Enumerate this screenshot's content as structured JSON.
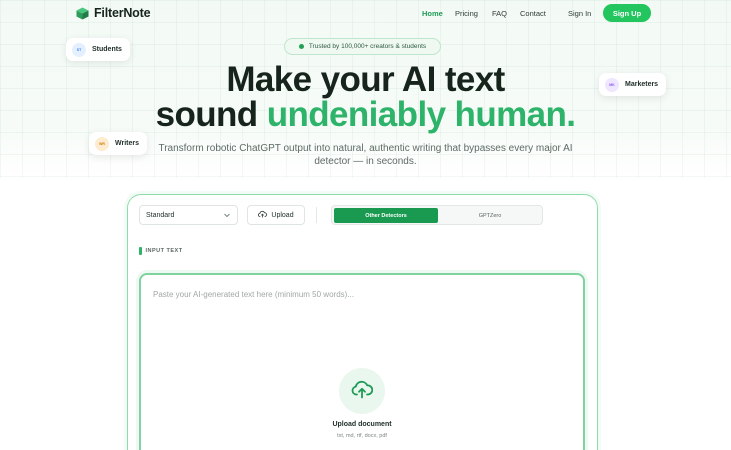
{
  "header": {
    "brand": "FilterNote",
    "nav": [
      {
        "label": "Home",
        "active": true
      },
      {
        "label": "Pricing",
        "active": false
      },
      {
        "label": "FAQ",
        "active": false
      },
      {
        "label": "Contact",
        "active": false
      }
    ],
    "sign_in": "Sign In",
    "sign_up": "Sign Up"
  },
  "hero": {
    "trust_badge": "Trusted by 100,000+ creators & students",
    "headline_line1": "Make your AI text",
    "headline_line2_prefix": "sound ",
    "headline_line2_highlight": "undeniably human.",
    "subtitle": "Transform robotic ChatGPT output into natural, authentic writing that bypasses every major AI detector — in seconds.",
    "chips": [
      {
        "initials": "ST",
        "label": "Students",
        "color": "#3b82f6",
        "bg": "#e4efff"
      },
      {
        "initials": "WR",
        "label": "Writers",
        "color": "#d97706",
        "bg": "#fdeccf"
      },
      {
        "initials": "MK",
        "label": "Marketers",
        "color": "#8b5cf6",
        "bg": "#efe6ff"
      }
    ]
  },
  "editor": {
    "mode_select": "Standard",
    "upload_label": "Upload",
    "detector_tabs": [
      {
        "label": "Other Detectors",
        "active": true
      },
      {
        "label": "GPTZero",
        "active": false
      }
    ],
    "input_label": "INPUT TEXT",
    "placeholder": "Paste your AI-generated text here (minimum 50 words)...",
    "upload_title": "Upload document",
    "upload_formats": "txt, md, rtf, docx, pdf"
  },
  "colors": {
    "accent": "#2eb36a",
    "accent_dark": "#1a9a50",
    "signup": "#22c55e"
  }
}
